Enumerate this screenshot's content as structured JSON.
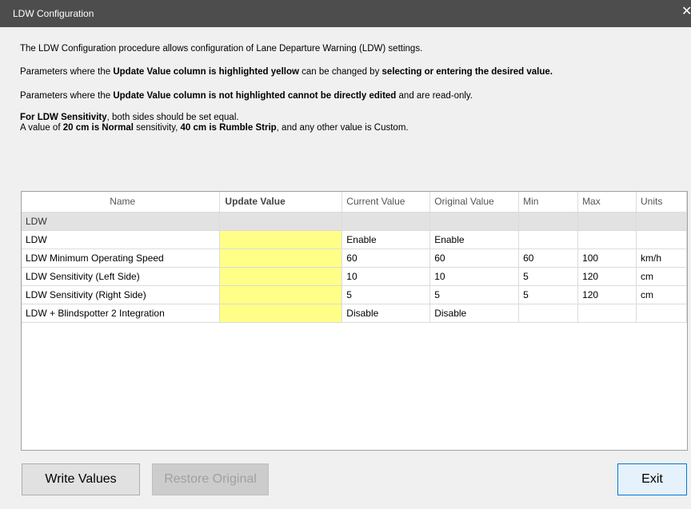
{
  "window": {
    "title": "LDW Configuration",
    "close_glyph": "✕"
  },
  "intro": {
    "line1": "The LDW Configuration procedure allows configuration of Lane Departure Warning (LDW) settings.",
    "line2_a": "Parameters where the ",
    "line2_b": "Update Value column is highlighted yellow",
    "line2_c": " can be changed by ",
    "line2_d": "selecting or entering the desired value.",
    "line3_a": "Parameters where the ",
    "line3_b": "Update Value column is not highlighted cannot be directly edited",
    "line3_c": " and are read-only.",
    "line4_a": "For LDW Sensitivity",
    "line4_b": ", both sides should be set equal.",
    "line5_a": "A value of ",
    "line5_b": "20 cm is Normal",
    "line5_c": " sensitivity, ",
    "line5_d": "40 cm is Rumble Strip",
    "line5_e": ", and any other value is Custom."
  },
  "table": {
    "headers": [
      "Name",
      "Update Value",
      "Current Value",
      "Original Value",
      "Min",
      "Max",
      "Units"
    ],
    "group": "LDW",
    "rows": [
      {
        "name": "LDW",
        "update": "",
        "current": "Enable",
        "original": "Enable",
        "min": "",
        "max": "",
        "units": ""
      },
      {
        "name": "LDW Minimum Operating Speed",
        "update": "",
        "current": "60",
        "original": "60",
        "min": "60",
        "max": "100",
        "units": "km/h"
      },
      {
        "name": "LDW Sensitivity (Left Side)",
        "update": "",
        "current": "10",
        "original": "10",
        "min": "5",
        "max": "120",
        "units": "cm"
      },
      {
        "name": "LDW Sensitivity (Right Side)",
        "update": "",
        "current": "5",
        "original": "5",
        "min": "5",
        "max": "120",
        "units": "cm"
      },
      {
        "name": "LDW + Blindspotter 2 Integration",
        "update": "",
        "current": "Disable",
        "original": "Disable",
        "min": "",
        "max": "",
        "units": ""
      }
    ]
  },
  "buttons": {
    "write": "Write Values",
    "restore": "Restore Original",
    "exit": "Exit"
  },
  "colors": {
    "editable_highlight": "#ffff88",
    "titlebar": "#4d4d4d",
    "accent_border": "#0078d7"
  }
}
